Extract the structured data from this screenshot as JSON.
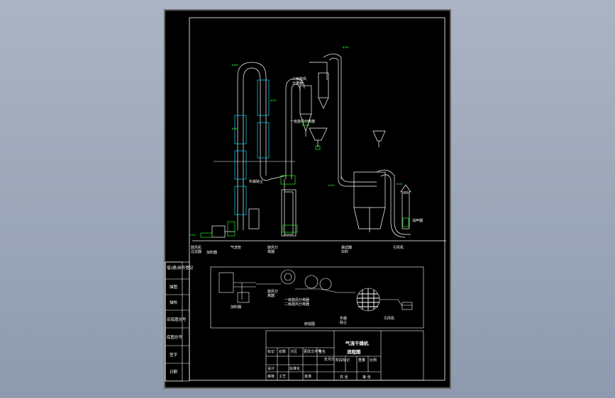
{
  "drawing": {
    "title_line1": "气流干燥机",
    "title_line2": "流程图",
    "side_labels": [
      "借(通)用件登记",
      "描图",
      "描校",
      "旧底图总号",
      "底图总号",
      "签字",
      "日期"
    ],
    "elevation_labels": [
      {
        "id": "l1",
        "text": "鼓风机\n过滤器"
      },
      {
        "id": "l2",
        "text": "加料器"
      },
      {
        "id": "l3",
        "text": "气流管"
      },
      {
        "id": "l4",
        "text": "旋风分\n离器"
      },
      {
        "id": "l5",
        "text": "二级旋风\n分离器"
      },
      {
        "id": "l6",
        "text": "袋滤器\n出料"
      },
      {
        "id": "l7",
        "text": "引风机"
      },
      {
        "id": "l8",
        "text": "消声器"
      },
      {
        "id": "l9",
        "text": "一级旋风分离器"
      },
      {
        "id": "l10",
        "text": "布袋除尘"
      }
    ],
    "plan_labels": [
      {
        "id": "p1",
        "text": "加料器"
      },
      {
        "id": "p2",
        "text": "旋风分\n离器"
      },
      {
        "id": "p3",
        "text": "一级旋风分离器\n二级旋风分离器"
      },
      {
        "id": "p4",
        "text": "布袋\n除尘"
      },
      {
        "id": "p5",
        "text": "引风机"
      },
      {
        "id": "p6",
        "text": "俯视图"
      }
    ],
    "table_labels": [
      "标记",
      "处数",
      "分区",
      "更改文件号",
      "签名",
      "年月日",
      "设计",
      "标准化",
      "阶段标记",
      "重量",
      "比例",
      "审核",
      "工艺",
      "批准",
      "共 张",
      "第 张"
    ],
    "tags": [
      "Φ400",
      "Φ300",
      "Φ250",
      "Φ200",
      "Φ150",
      "Φ100",
      "H=8m"
    ],
    "colors": {
      "background": "#000000",
      "line": "#ffffff",
      "pipe": "#ffffff",
      "tag": "#22ee22",
      "cyan": "#00e0ff"
    }
  }
}
